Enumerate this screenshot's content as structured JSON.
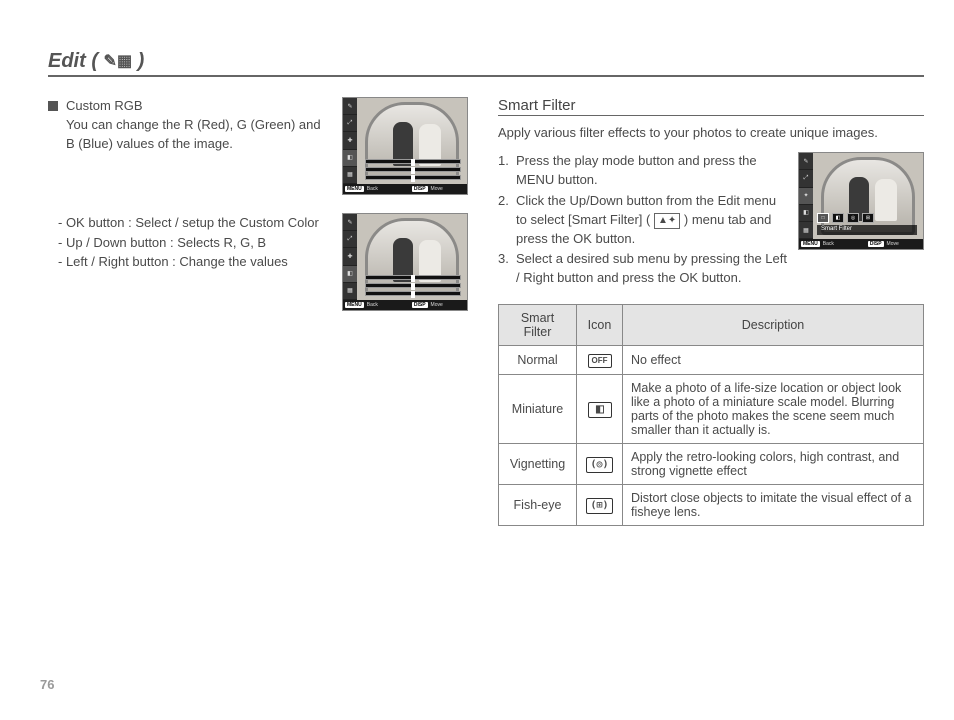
{
  "page_number": "76",
  "title_prefix": "Edit ( ",
  "title_icon": "edit-palette-icon",
  "title_suffix": " )",
  "left": {
    "heading": "Custom RGB",
    "desc": "You can change the R (Red), G (Green) and B (Blue) values of the image.",
    "controls": [
      "- OK button : Select / setup the Custom Color",
      "- Up / Down button  : Selects R, G, B",
      "- Left / Right button  : Change the values"
    ],
    "cam": {
      "back": "Back",
      "move": "Move",
      "menu": "MENU",
      "disp": "DISP"
    }
  },
  "right": {
    "subtitle": "Smart Filter",
    "intro": "Apply various filter effects to your photos to create unique images.",
    "steps": [
      {
        "n": "1.",
        "t_a": "Press the play mode button and press the MENU button.",
        "t_b": ""
      },
      {
        "n": "2.",
        "t_a": "Click the Up/Down button from the Edit menu to select [Smart Filter] ( ",
        "t_b": " ) menu tab and press the OK button."
      },
      {
        "n": "3.",
        "t_a": "Select a desired sub menu by pressing the Left / Right button and press the OK button.",
        "t_b": ""
      }
    ],
    "inline_icon": "smart-filter-icon",
    "cam": {
      "back": "Back",
      "move": "Move",
      "label": "Smart Filter",
      "menu": "MENU",
      "disp": "DISP"
    },
    "table": {
      "headers": [
        "Smart Filter",
        "Icon",
        "Description"
      ],
      "rows": [
        {
          "name": "Normal",
          "icon": "normal-off-icon",
          "glyph": "OFF",
          "desc": "No effect"
        },
        {
          "name": "Miniature",
          "icon": "miniature-icon",
          "glyph": "◧",
          "desc": "Make a photo of a life-size location or object look like a photo of a miniature scale model. Blurring parts of the photo makes the scene seem much smaller than it actually is."
        },
        {
          "name": "Vignetting",
          "icon": "vignetting-icon",
          "glyph": "(◎)",
          "desc": "Apply the retro-looking colors, high contrast, and strong vignette effect"
        },
        {
          "name": "Fish-eye",
          "icon": "fisheye-icon",
          "glyph": "(⊞)",
          "desc": "Distort close objects to imitate the visual effect of a fisheye lens."
        }
      ]
    }
  }
}
